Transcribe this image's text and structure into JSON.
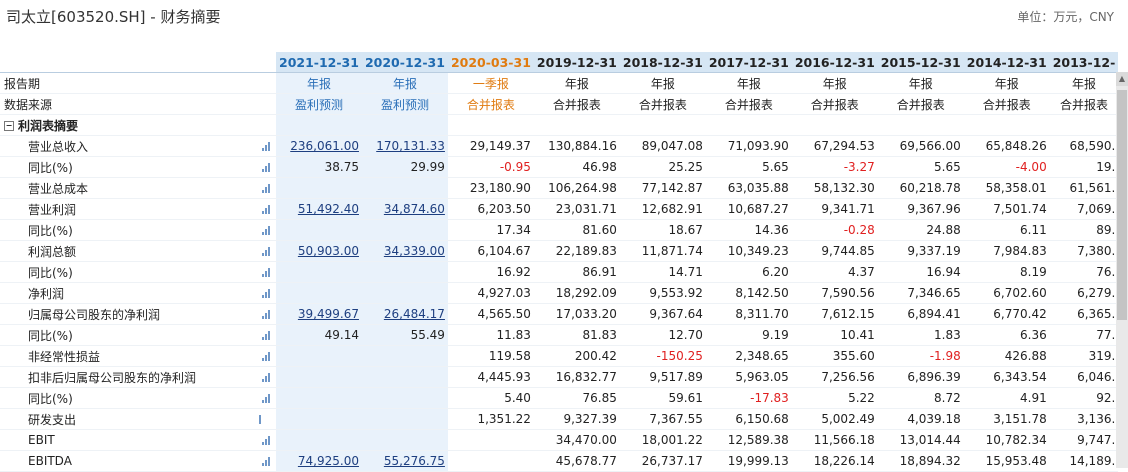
{
  "title": "司太立[603520.SH] - 财务摘要",
  "unit": "单位：万元，CNY",
  "columns": [
    {
      "date": "2021-12-31",
      "period": "年报",
      "source": "盈利预测"
    },
    {
      "date": "2020-12-31",
      "period": "年报",
      "source": "盈利预测"
    },
    {
      "date": "2020-03-31",
      "period": "一季报",
      "source": "合并报表"
    },
    {
      "date": "2019-12-31",
      "period": "年报",
      "source": "合并报表"
    },
    {
      "date": "2018-12-31",
      "period": "年报",
      "source": "合并报表"
    },
    {
      "date": "2017-12-31",
      "period": "年报",
      "source": "合并报表"
    },
    {
      "date": "2016-12-31",
      "period": "年报",
      "source": "合并报表"
    },
    {
      "date": "2015-12-31",
      "period": "年报",
      "source": "合并报表"
    },
    {
      "date": "2014-12-31",
      "period": "年报",
      "source": "合并报表"
    },
    {
      "date": "2013-12-",
      "period": "年报",
      "source": "合并报表"
    }
  ],
  "labels": {
    "period": "报告期",
    "source": "数据来源",
    "section": "利润表摘要"
  },
  "rows": [
    {
      "name": "营业总收入",
      "vals": [
        "236,061.00",
        "170,131.33",
        "29,149.37",
        "130,884.16",
        "89,047.08",
        "71,093.90",
        "67,294.53",
        "69,566.00",
        "65,848.26",
        "68,590."
      ]
    },
    {
      "name": "同比(%)",
      "sub": true,
      "vals": [
        "38.75",
        "29.99",
        "-0.95",
        "46.98",
        "25.25",
        "5.65",
        "-3.27",
        "5.65",
        "-4.00",
        "19."
      ]
    },
    {
      "name": "营业总成本",
      "vals": [
        "",
        "",
        "23,180.90",
        "106,264.98",
        "77,142.87",
        "63,035.88",
        "58,132.30",
        "60,218.78",
        "58,358.01",
        "61,561."
      ]
    },
    {
      "name": "营业利润",
      "vals": [
        "51,492.40",
        "34,874.60",
        "6,203.50",
        "23,031.71",
        "12,682.91",
        "10,687.27",
        "9,341.71",
        "9,367.96",
        "7,501.74",
        "7,069."
      ]
    },
    {
      "name": "同比(%)",
      "sub": true,
      "vals": [
        "",
        "",
        "17.34",
        "81.60",
        "18.67",
        "14.36",
        "-0.28",
        "24.88",
        "6.11",
        "89."
      ]
    },
    {
      "name": "利润总额",
      "vals": [
        "50,903.00",
        "34,339.00",
        "6,104.67",
        "22,189.83",
        "11,871.74",
        "10,349.23",
        "9,744.85",
        "9,337.19",
        "7,984.83",
        "7,380."
      ]
    },
    {
      "name": "同比(%)",
      "sub": true,
      "vals": [
        "",
        "",
        "16.92",
        "86.91",
        "14.71",
        "6.20",
        "4.37",
        "16.94",
        "8.19",
        "76."
      ]
    },
    {
      "name": "净利润",
      "vals": [
        "",
        "",
        "4,927.03",
        "18,292.09",
        "9,553.92",
        "8,142.50",
        "7,590.56",
        "7,346.65",
        "6,702.60",
        "6,279."
      ]
    },
    {
      "name": "归属母公司股东的净利润",
      "vals": [
        "39,499.67",
        "26,484.17",
        "4,565.50",
        "17,033.20",
        "9,367.64",
        "8,311.70",
        "7,612.15",
        "6,894.41",
        "6,770.42",
        "6,365."
      ]
    },
    {
      "name": "同比(%)",
      "sub": true,
      "vals": [
        "49.14",
        "55.49",
        "11.83",
        "81.83",
        "12.70",
        "9.19",
        "10.41",
        "1.83",
        "6.36",
        "77."
      ]
    },
    {
      "name": "非经常性损益",
      "vals": [
        "",
        "",
        "119.58",
        "200.42",
        "-150.25",
        "2,348.65",
        "355.60",
        "-1.98",
        "426.88",
        "319."
      ]
    },
    {
      "name": "扣非后归属母公司股东的净利润",
      "vals": [
        "",
        "",
        "4,445.93",
        "16,832.77",
        "9,517.89",
        "5,963.05",
        "7,256.56",
        "6,896.39",
        "6,343.54",
        "6,046."
      ]
    },
    {
      "name": "同比(%)",
      "sub": true,
      "vals": [
        "",
        "",
        "5.40",
        "76.85",
        "59.61",
        "-17.83",
        "5.22",
        "8.72",
        "4.91",
        "92."
      ]
    },
    {
      "name": "研发支出",
      "help": true,
      "vals": [
        "",
        "",
        "1,351.22",
        "9,327.39",
        "7,367.55",
        "6,150.68",
        "5,002.49",
        "4,039.18",
        "3,151.78",
        "3,136."
      ]
    },
    {
      "name": "EBIT",
      "vals": [
        "",
        "",
        "",
        "34,470.00",
        "18,001.22",
        "12,589.38",
        "11,566.18",
        "13,014.44",
        "10,782.34",
        "9,747."
      ]
    },
    {
      "name": "EBITDA",
      "vals": [
        "74,925.00",
        "55,276.75",
        "",
        "45,678.77",
        "26,737.17",
        "19,999.13",
        "18,226.14",
        "18,894.32",
        "15,953.48",
        "14,189."
      ]
    }
  ],
  "linked_rows": [
    0,
    3,
    5,
    8,
    14,
    15
  ],
  "colors": {
    "accent": "#1f6ab0",
    "forecast_bg": "#e9f2fb",
    "negative": "#e02020",
    "quarter": "#e07b10"
  }
}
